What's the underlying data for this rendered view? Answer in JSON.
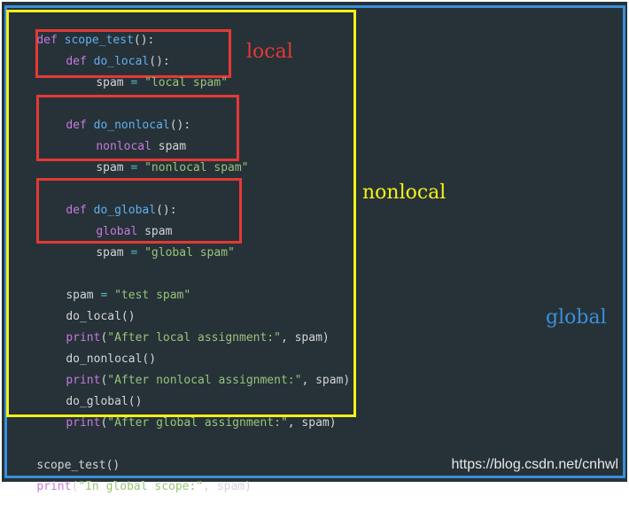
{
  "code": {
    "def_kw": "def",
    "scope_test_name": "scope_test",
    "parens_colon": "():",
    "do_local_name": "do_local",
    "do_nonlocal_name": "do_nonlocal",
    "do_global_name": "do_global",
    "spam_var": "spam",
    "assign_op": " = ",
    "local_spam_str": "\"local spam\"",
    "nonlocal_kw": "nonlocal",
    "nonlocal_spam_str": "\"nonlocal spam\"",
    "global_kw": "global",
    "global_spam_str": "\"global spam\"",
    "test_spam_str": "\"test spam\"",
    "do_local_call": "do_local()",
    "do_nonlocal_call": "do_nonlocal()",
    "do_global_call": "do_global()",
    "print_fn": "print",
    "after_local_str": "\"After local assignment:\"",
    "after_nonlocal_str": "\"After nonlocal assignment:\"",
    "after_global_str": "\"After global assignment:\"",
    "comma_spam_close": ", spam)",
    "open_paren": "(",
    "scope_test_call": "scope_test()",
    "in_global_str": "\"In global scope:\""
  },
  "labels": {
    "local": "local",
    "nonlocal": "nonlocal",
    "global": "global"
  },
  "watermark": "https://blog.csdn.net/cnhwl",
  "colors": {
    "background": "#263238",
    "keyword": "#c678dd",
    "function": "#61afef",
    "string": "#98c379",
    "operator": "#56b6c2",
    "local_box": "#e53935",
    "nonlocal_box": "#f4f118",
    "global_box": "#3a8fd9"
  }
}
